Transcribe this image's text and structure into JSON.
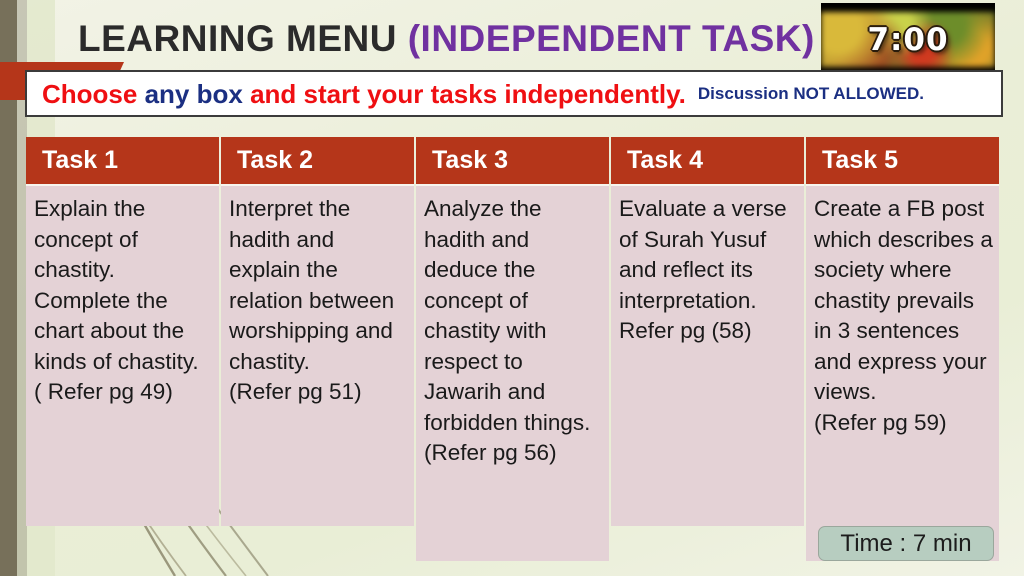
{
  "slide": {
    "title_main": "LEARNING MENU ",
    "title_accent": "(INDEPENDENT TASK)",
    "background_color": "#eaeed7",
    "accent_color": "#7031a0",
    "brick_color": "#b5361a"
  },
  "timer": {
    "value": "7:00",
    "label": "countdown-timer-image"
  },
  "banner": {
    "part1": "Choose ",
    "part2": "any box ",
    "part3": "and start your tasks independently.",
    "note": "Discussion NOT ALLOWED.",
    "color_red": "#ef0f12",
    "color_blue": "#1b2f82"
  },
  "tasks": [
    {
      "header": "Task 1",
      "body": "Explain the concept of chastity. Complete the chart about the kinds of chastity.\n( Refer pg 49)"
    },
    {
      "header": "Task 2",
      "body": "Interpret the hadith and explain the relation between worshipping and chastity.\n(Refer pg 51)"
    },
    {
      "header": "Task 3",
      "body": "Analyze the hadith and deduce the concept of chastity with respect to Jawarih and forbidden things.\n(Refer pg 56)"
    },
    {
      "header": "Task 4",
      "body": "Evaluate a verse of Surah Yusuf and reflect its interpretation. Refer pg (58)"
    },
    {
      "header": "Task 5",
      "body": "Create a FB post which describes a society where chastity prevails in 3 sentences and express your views.\n(Refer pg 59)"
    }
  ],
  "time_badge": {
    "label": "Time : 7 min"
  }
}
